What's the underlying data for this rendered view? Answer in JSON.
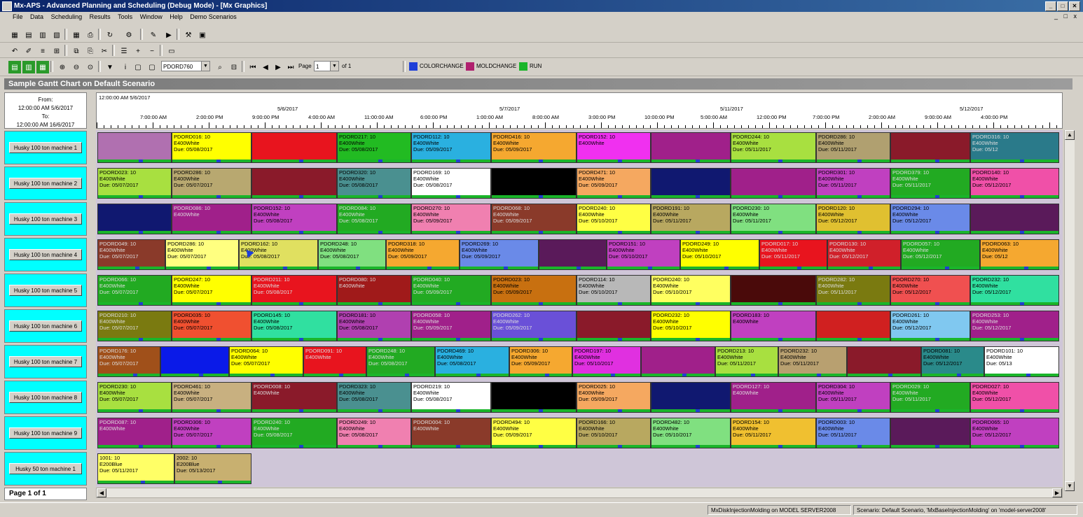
{
  "window": {
    "title": "Mx-APS - Advanced Planning and Scheduling (Debug Mode) - [Mx Graphics]",
    "buttons": [
      "_",
      "□",
      "✕"
    ]
  },
  "menu": [
    "File",
    "Data",
    "Scheduling",
    "Results",
    "Tools",
    "Window",
    "Help",
    "Demo Scenarios"
  ],
  "toolbar": {
    "order_combo": "PDORD760",
    "page_label": "Page",
    "page_value": "1",
    "page_of": "of 1",
    "legend": [
      {
        "label": "COLORCHANGE",
        "color": "#1e3fd8"
      },
      {
        "label": "MOLDCHANGE",
        "color": "#b0206e"
      },
      {
        "label": "RUN",
        "color": "#1ab52a"
      }
    ]
  },
  "panel": {
    "title": "Sample Gantt Chart on Default Scenario"
  },
  "date_range": {
    "from_label": "From:",
    "from": "12:00:00 AM 5/6/2017",
    "to_label": "To:",
    "to": "12:00:00 AM 16/6/2017"
  },
  "timeline": {
    "start": "12:00:00 AM 5/6/2017",
    "dates": [
      "5/6/2017",
      "5/7/2017",
      "5/11/2017",
      "5/12/2017"
    ],
    "times": [
      "7:00:00 AM",
      "2:00:00 PM",
      "9:00:00 PM",
      "4:00:00 AM",
      "11:00:00 AM",
      "6:00:00 PM",
      "1:00:00 AM",
      "8:00:00 AM",
      "3:00:00 PM",
      "10:00:00 PM",
      "5:00:00 AM",
      "12:00:00 PM",
      "7:00:00 PM",
      "2:00:00 AM",
      "9:00:00 AM",
      "4:00:00 PM"
    ]
  },
  "resources": [
    "Husky 100 ton machine 1",
    "Husky 100 ton machine 2",
    "Husky 100 ton machine 3",
    "Husky 100 ton machine 4",
    "Husky 100 ton machine 5",
    "Husky 100 ton machine 6",
    "Husky 100 ton machine 7",
    "Husky 100 ton machine 8",
    "Husky 100 ton machine 9",
    "Husky 50 ton machine 1"
  ],
  "rows": [
    [
      {
        "l": "",
        "c": "#b070b0"
      },
      {
        "l": "PDORD016: 10",
        "s": "E400White",
        "d": "Due: 05/08/2017",
        "c": "#ffff00"
      },
      {
        "l": "",
        "c": "#e8141e"
      },
      {
        "l": "PDORD217: 10",
        "s": "E400White",
        "d": "Due: 05/08/2017",
        "c": "#22bb22"
      },
      {
        "l": "PDORD112: 10",
        "s": "E400White",
        "d": "Due: 05/09/2017",
        "c": "#2ab0e0"
      },
      {
        "l": "PDORD416: 10",
        "s": "E400White",
        "d": "Due: 05/09/2017",
        "c": "#f5a830"
      },
      {
        "l": "PDORD152: 10",
        "s": "E400White",
        "d": "",
        "c": "#f030f0"
      },
      {
        "l": "",
        "c": "#a0208a"
      },
      {
        "l": "PDORD244: 10",
        "s": "E400White",
        "d": "Due: 05/11/2017",
        "c": "#a8e040"
      },
      {
        "l": "PDORD286: 10",
        "s": "E400White",
        "d": "Due: 05/11/2017",
        "c": "#b0a070"
      },
      {
        "l": "",
        "c": "#8a1a2a"
      },
      {
        "l": "PDORD316: 10",
        "s": "E400White",
        "d": "Due: 05/12",
        "c": "#2a7a8a"
      }
    ],
    [
      {
        "l": "PDORD023: 10",
        "s": "E400White",
        "d": "Due: 05/07/2017",
        "c": "#a8e040"
      },
      {
        "l": "PDORD286: 10",
        "s": "E400White",
        "d": "Due: 05/07/2017",
        "c": "#b8a870"
      },
      {
        "l": "",
        "c": "#8a1a2a"
      },
      {
        "l": "PDORD320: 10",
        "s": "E400White",
        "d": "Due: 05/08/2017",
        "c": "#4a9090"
      },
      {
        "l": "PDORD169: 10",
        "s": "E400White",
        "d": "Due: 05/08/2017",
        "c": "#ffffff"
      },
      {
        "l": "",
        "c": "#000000"
      },
      {
        "l": "PDORD471: 10",
        "s": "E400White",
        "d": "Due: 05/09/2017",
        "c": "#f5a860"
      },
      {
        "l": "",
        "c": "#101870"
      },
      {
        "l": "",
        "c": "#a0208a"
      },
      {
        "l": "PDORD301: 10",
        "s": "E400White",
        "d": "Due: 05/11/2017",
        "c": "#c040c0"
      },
      {
        "l": "PDORD379: 10",
        "s": "E400White",
        "d": "Due: 05/11/2017",
        "c": "#22aa22"
      },
      {
        "l": "PDORD140: 10",
        "s": "E400White",
        "d": "Due: 05/12/2017",
        "c": "#f050a8"
      }
    ],
    [
      {
        "l": "",
        "c": "#101870"
      },
      {
        "l": "PDORD086: 10",
        "s": "E400White",
        "d": "",
        "c": "#a0208a"
      },
      {
        "l": "PDORD152: 10",
        "s": "E400White",
        "d": "Due: 05/08/2017",
        "c": "#c040c0"
      },
      {
        "l": "PDORD084: 10",
        "s": "E400White",
        "d": "Due: 05/08/2017",
        "c": "#22aa22"
      },
      {
        "l": "PDORD270: 10",
        "s": "E400White",
        "d": "Due: 05/09/2017",
        "c": "#f080b0"
      },
      {
        "l": "PDORD068: 10",
        "s": "E400White",
        "d": "Due: 05/09/2017",
        "c": "#8a3a2a"
      },
      {
        "l": "PDORD240: 10",
        "s": "E400White",
        "d": "Due: 05/10/2017",
        "c": "#ffff44"
      },
      {
        "l": "PDORD191: 10",
        "s": "E400White",
        "d": "Due: 05/11/2017",
        "c": "#b8a860"
      },
      {
        "l": "PDORD230: 10",
        "s": "E400White",
        "d": "Due: 05/11/2017",
        "c": "#80e080"
      },
      {
        "l": "PDORD120: 10",
        "s": "E400White",
        "d": "Due: 05/12/2017",
        "c": "#e0c030"
      },
      {
        "l": "PDORD294: 10",
        "s": "E400White",
        "d": "Due: 05/12/2017",
        "c": "#6a8ae8"
      },
      {
        "l": "",
        "c": "#5a1a5a"
      }
    ],
    [
      {
        "l": "PDORD049: 10",
        "s": "E400White",
        "d": "Due: 05/07/2017",
        "c": "#8a3a2a"
      },
      {
        "l": "PDORD286: 10",
        "s": "E400White",
        "d": "Due: 05/07/2017",
        "c": "#ffff80"
      },
      {
        "l": "PDORD162: 10",
        "s": "E400White",
        "d": "Due: 05/08/2017",
        "c": "#e0e060"
      },
      {
        "l": "PDORD248: 10",
        "s": "E400White",
        "d": "Due: 05/08/2017",
        "c": "#80e080"
      },
      {
        "l": "PDORD318: 10",
        "s": "E400White",
        "d": "Due: 05/09/2017",
        "c": "#f5a830"
      },
      {
        "l": "PDORD269: 10",
        "s": "E400White",
        "d": "Due: 05/09/2017",
        "c": "#6a8ae8"
      },
      {
        "l": "",
        "c": "#5a1a5a"
      },
      {
        "l": "PDORD151: 10",
        "s": "E400White",
        "d": "Due: 05/10/2017",
        "c": "#c040c0"
      },
      {
        "l": "PDORD249: 10",
        "s": "E400White",
        "d": "Due: 05/10/2017",
        "c": "#ffff00"
      },
      {
        "l": "PDORD017: 10",
        "s": "E400White",
        "d": "Due: 05/11/2017",
        "c": "#e8141e"
      },
      {
        "l": "PDORD130: 10",
        "s": "E400White",
        "d": "Due: 05/12/2017",
        "c": "#d0202a"
      },
      {
        "l": "PDORD057: 10",
        "s": "E400White",
        "d": "Due: 05/12/2017",
        "c": "#22aa22"
      },
      {
        "l": "PDORD063: 10",
        "s": "E400White",
        "d": "Due: 05/12",
        "c": "#f5a830"
      }
    ],
    [
      {
        "l": "PDORD066: 10",
        "s": "E400White",
        "d": "Due: 05/07/2017",
        "c": "#22aa22"
      },
      {
        "l": "PDORD247: 10",
        "s": "E400White",
        "d": "Due: 05/07/2017",
        "c": "#ffff00"
      },
      {
        "l": "PDORD211: 10",
        "s": "E400White",
        "d": "Due: 05/08/2017",
        "c": "#e8141e"
      },
      {
        "l": "PDORD080: 10",
        "s": "E400White",
        "d": "",
        "c": "#a01a1a"
      },
      {
        "l": "PDORD040: 10",
        "s": "E400White",
        "d": "Due: 05/09/2017",
        "c": "#22aa22"
      },
      {
        "l": "PDORD023: 10",
        "s": "E400White",
        "d": "Due: 05/09/2017",
        "c": "#c87010"
      },
      {
        "l": "PDORD114: 10",
        "s": "E400White",
        "d": "Due: 05/10/2017",
        "c": "#b8b8b8"
      },
      {
        "l": "PDORD240: 10",
        "s": "E400White",
        "d": "Due: 05/10/2017",
        "c": "#ffff60"
      },
      {
        "l": "",
        "c": "#4a0a0a"
      },
      {
        "l": "PDORD282: 10",
        "s": "E400White",
        "d": "Due: 05/11/2017",
        "c": "#7a7a10"
      },
      {
        "l": "PDORD270: 10",
        "s": "E400White",
        "d": "Due: 05/12/2017",
        "c": "#f05050"
      },
      {
        "l": "PDORD232: 10",
        "s": "E400White",
        "d": "Due: 05/12/2017",
        "c": "#30e0a0"
      }
    ],
    [
      {
        "l": "PDORD210: 10",
        "s": "E400White",
        "d": "Due: 05/07/2017",
        "c": "#7a7a10"
      },
      {
        "l": "PDORD035: 10",
        "s": "E400White",
        "d": "Due: 05/07/2017",
        "c": "#f05030"
      },
      {
        "l": "PDORD145: 10",
        "s": "E400White",
        "d": "Due: 05/08/2017",
        "c": "#30e0a0"
      },
      {
        "l": "PDORD181: 10",
        "s": "E400White",
        "d": "Due: 05/08/2017",
        "c": "#b040b0"
      },
      {
        "l": "PDORD058: 10",
        "s": "E400White",
        "d": "Due: 05/09/2017",
        "c": "#a0208a"
      },
      {
        "l": "PDORD262: 10",
        "s": "E400White",
        "d": "Due: 05/09/2017",
        "c": "#6a50d8"
      },
      {
        "l": "",
        "c": "#8a1a2a"
      },
      {
        "l": "PDORD232: 10",
        "s": "E400White",
        "d": "Due: 05/10/2017",
        "c": "#ffff00"
      },
      {
        "l": "PDORD183: 10",
        "s": "E400White",
        "d": "",
        "c": "#c040c0"
      },
      {
        "l": "",
        "c": "#d02020"
      },
      {
        "l": "PDORD261: 10",
        "s": "E400White",
        "d": "Due: 05/12/2017",
        "c": "#80c8f0"
      },
      {
        "l": "PDORD253: 10",
        "s": "E400White",
        "d": "Due: 05/12/2017",
        "c": "#a0208a"
      }
    ],
    [
      {
        "l": "PDORD176: 10",
        "s": "E400White",
        "d": "Due: 05/07/2017",
        "c": "#a0501a"
      },
      {
        "l": "",
        "c": "#0a1ae8"
      },
      {
        "l": "PDORD064: 10",
        "s": "E400White",
        "d": "Due: 05/07/2017",
        "c": "#ffff00"
      },
      {
        "l": "PDORD091: 10",
        "s": "E400White",
        "d": "",
        "c": "#e8141e"
      },
      {
        "l": "PDORD248: 10",
        "s": "E400White",
        "d": "Due: 05/08/2017",
        "c": "#22aa22"
      },
      {
        "l": "PDORD469: 10",
        "s": "E400White",
        "d": "Due: 05/08/2017",
        "c": "#2ab0e0"
      },
      {
        "l": "PDORD306: 10",
        "s": "E400White",
        "d": "Due: 05/09/2017",
        "c": "#f5a830"
      },
      {
        "l": "PDORD197: 10",
        "s": "E400White",
        "d": "Due: 05/10/2017",
        "c": "#e030e0"
      },
      {
        "l": "",
        "c": "#a0208a"
      },
      {
        "l": "PDORD213: 10",
        "s": "E400White",
        "d": "Due: 05/11/2017",
        "c": "#a8e040"
      },
      {
        "l": "PDORD232: 10",
        "s": "E400White",
        "d": "Due: 05/11/2017",
        "c": "#b8a070"
      },
      {
        "l": "",
        "c": "#8a1a2a"
      },
      {
        "l": "PDORD081: 10",
        "s": "E400White",
        "d": "Due: 05/12/2017",
        "c": "#2a8a8a"
      },
      {
        "l": "PDORD101: 10",
        "s": "E400White",
        "d": "Due: 05/13",
        "c": "#ffffff"
      }
    ],
    [
      {
        "l": "PDORD230: 10",
        "s": "E400White",
        "d": "Due: 05/07/2017",
        "c": "#a8e040"
      },
      {
        "l": "PDORD461: 10",
        "s": "E400White",
        "d": "Due: 05/07/2017",
        "c": "#c8b080"
      },
      {
        "l": "PDORD008: 10",
        "s": "E400White",
        "d": "",
        "c": "#8a1a2a"
      },
      {
        "l": "PDORD323: 10",
        "s": "E400White",
        "d": "Due: 05/08/2017",
        "c": "#4a9090"
      },
      {
        "l": "PDORD219: 10",
        "s": "E400White",
        "d": "Due: 05/08/2017",
        "c": "#ffffff"
      },
      {
        "l": "",
        "c": "#000000"
      },
      {
        "l": "PDORD025: 10",
        "s": "E400White",
        "d": "Due: 05/09/2017",
        "c": "#f5a860"
      },
      {
        "l": "",
        "c": "#101870"
      },
      {
        "l": "PDORD127: 10",
        "s": "E400White",
        "d": "",
        "c": "#a0208a"
      },
      {
        "l": "PDORD304: 10",
        "s": "E400White",
        "d": "Due: 05/11/2017",
        "c": "#c040c0"
      },
      {
        "l": "PDORD029: 10",
        "s": "E400White",
        "d": "Due: 05/11/2017",
        "c": "#22aa22"
      },
      {
        "l": "PDORD027: 10",
        "s": "E400White",
        "d": "Due: 05/12/2017",
        "c": "#f050a8"
      }
    ],
    [
      {
        "l": "PDORD087: 10",
        "s": "E400White",
        "d": "",
        "c": "#a0208a"
      },
      {
        "l": "PDORD306: 10",
        "s": "E400White",
        "d": "Due: 05/07/2017",
        "c": "#c040c0"
      },
      {
        "l": "PDORD240: 10",
        "s": "E400White",
        "d": "Due: 05/08/2017",
        "c": "#22aa22"
      },
      {
        "l": "PDORD249: 10",
        "s": "E400White",
        "d": "Due: 05/08/2017",
        "c": "#f080b0"
      },
      {
        "l": "PDORD004: 10",
        "s": "E400White",
        "d": "",
        "c": "#8a3a2a"
      },
      {
        "l": "PDORD494: 10",
        "s": "E400White",
        "d": "Due: 05/09/2017",
        "c": "#ffff44"
      },
      {
        "l": "PDORD166: 10",
        "s": "E400White",
        "d": "Due: 05/10/2017",
        "c": "#b8a860"
      },
      {
        "l": "PDORD482: 10",
        "s": "E400White",
        "d": "Due: 05/10/2017",
        "c": "#80e080"
      },
      {
        "l": "PDORD154: 10",
        "s": "E400White",
        "d": "Due: 05/11/2017",
        "c": "#f0c030"
      },
      {
        "l": "PDORD003: 10",
        "s": "E400White",
        "d": "Due: 05/11/2017",
        "c": "#6a8ae8"
      },
      {
        "l": "",
        "c": "#5a1a5a"
      },
      {
        "l": "PDORD065: 10",
        "s": "E400White",
        "d": "Due: 05/12/2017",
        "c": "#c040c0"
      }
    ],
    [
      {
        "l": "1001: 10",
        "s": "E200Blue",
        "d": "Due: 05/11/2017",
        "c": "#ffff66"
      },
      {
        "l": "2002: 10",
        "s": "E200Blue",
        "d": "Due: 05/13/2017",
        "c": "#c8b070"
      }
    ]
  ],
  "pager": {
    "label": "Page 1 of 1"
  },
  "status": [
    "MxDiskInjectionMolding on MODEL SERVER2008",
    "Scenario: Default Scenario, 'MxBaseInjectionMolding' on 'model-server2008'"
  ]
}
